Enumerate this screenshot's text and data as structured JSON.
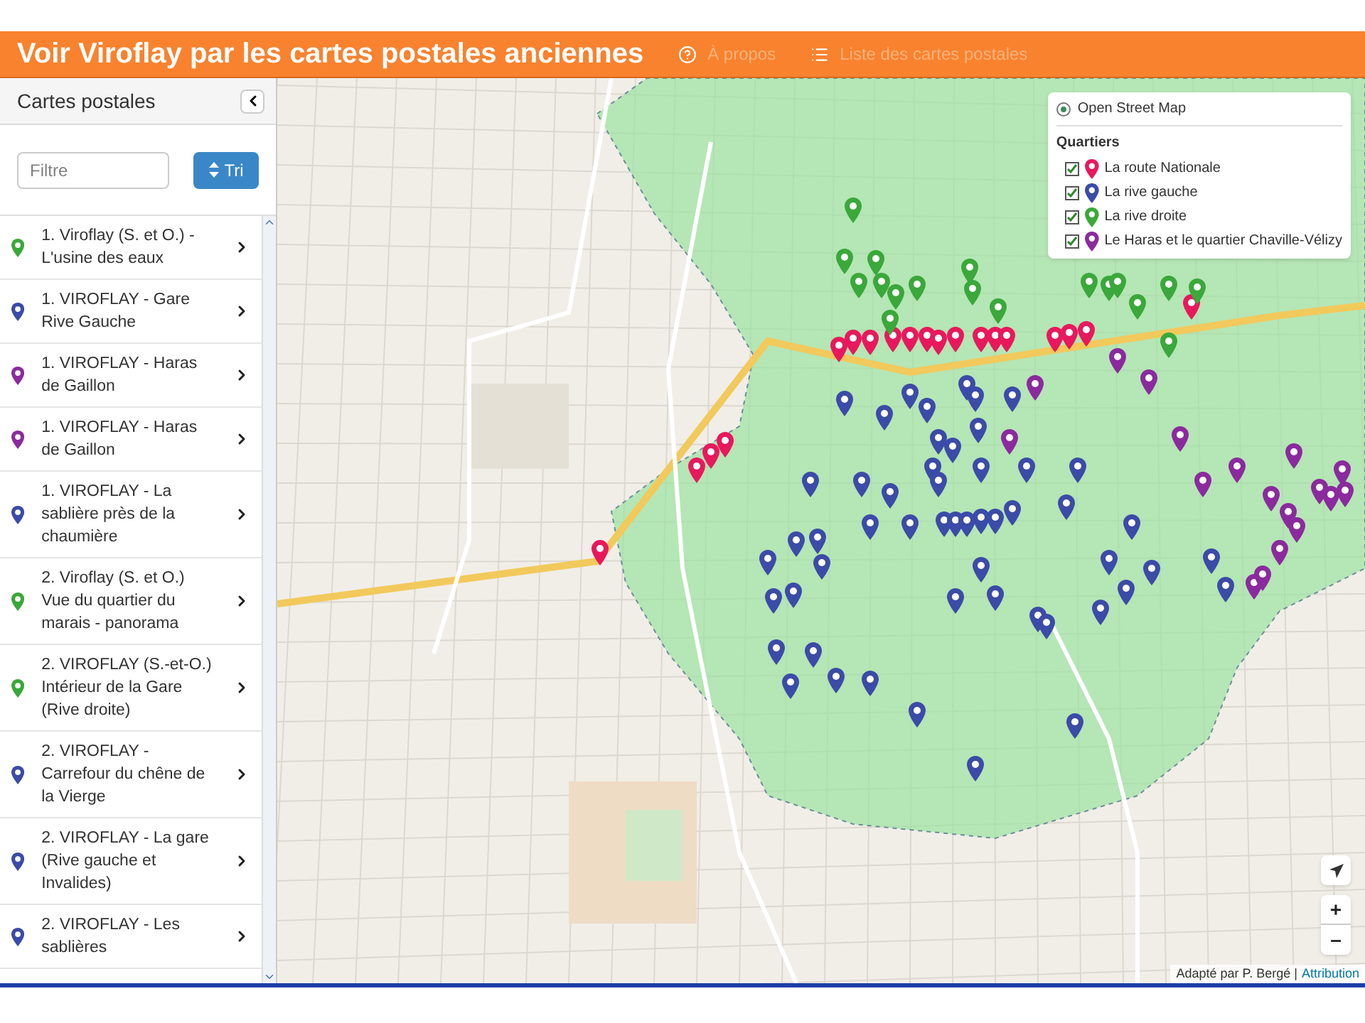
{
  "header": {
    "title": "Voir Viroflay par les cartes postales anciennes",
    "nav": [
      {
        "kind": "help",
        "label": "À propos"
      },
      {
        "kind": "list",
        "label": "Liste des cartes postales"
      }
    ]
  },
  "sidebar": {
    "title": "Cartes postales",
    "filter": {
      "placeholder": "Filtre"
    },
    "sort_button": "Tri",
    "items": [
      {
        "label": "1. Viroflay (S. et O.) - L'usine des eaux",
        "color": "#3aa83a"
      },
      {
        "label": "1. VIROFLAY - Gare Rive Gauche",
        "color": "#3b4ba8"
      },
      {
        "label": "1. VIROFLAY - Haras de Gaillon",
        "color": "#8b2a9e"
      },
      {
        "label": "1. VIROFLAY - Haras de Gaillon",
        "color": "#8b2a9e"
      },
      {
        "label": "1. VIROFLAY - La sablière près de la chaumière",
        "color": "#3b4ba8"
      },
      {
        "label": "2. Viroflay (S. et O.) Vue du quartier du marais - panorama",
        "color": "#3aa83a"
      },
      {
        "label": "2. VIROFLAY (S.-et-O.) Intérieur de la Gare (Rive droite)",
        "color": "#3aa83a"
      },
      {
        "label": "2. VIROFLAY - Carrefour du chêne de la Vierge",
        "color": "#3b4ba8"
      },
      {
        "label": "2. VIROFLAY - La gare (Rive gauche et Invalides)",
        "color": "#3b4ba8"
      },
      {
        "label": "2. VIROFLAY - Les sablières",
        "color": "#3b4ba8"
      }
    ]
  },
  "map": {
    "base_layer": {
      "label": "Open Street Map",
      "selected": true
    },
    "overlays_title": "Quartiers",
    "overlays": [
      {
        "label": "La route Nationale",
        "checked": true,
        "color": "#e8185c"
      },
      {
        "label": "La rive gauche",
        "checked": true,
        "color": "#3b4ba8"
      },
      {
        "label": "La rive droite",
        "checked": true,
        "color": "#3aa83a"
      },
      {
        "label": "Le Haras et le quartier Chaville-Vélizy",
        "checked": true,
        "color": "#8b2a9e"
      }
    ],
    "zoom_in": "+",
    "zoom_out": "–",
    "attribution": {
      "text": "Adapté par P. Bergé |",
      "link": "Attribution"
    }
  }
}
